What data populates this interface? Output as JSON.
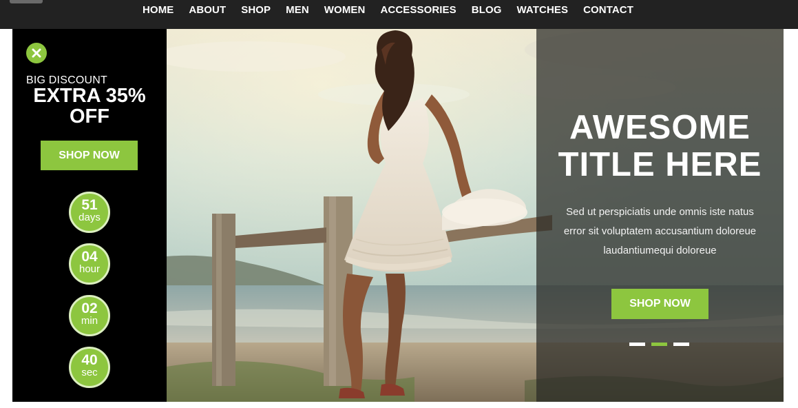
{
  "nav": {
    "items": [
      "HOME",
      "ABOUT",
      "SHOP",
      "MEN",
      "WOMEN",
      "ACCESSORIES",
      "BLOG",
      "WATCHES",
      "CONTACT"
    ]
  },
  "promo": {
    "eyebrow": "BIG DISCOUNT",
    "headline_line1": "EXTRA 35%",
    "headline_line2": "OFF",
    "button_label": "SHOP NOW",
    "countdown": [
      {
        "value": "51",
        "unit": "days"
      },
      {
        "value": "04",
        "unit": "hour"
      },
      {
        "value": "02",
        "unit": "min"
      },
      {
        "value": "40",
        "unit": "sec"
      }
    ]
  },
  "hero": {
    "title_line1": "AWESOME",
    "title_line2": "TITLE HERE",
    "desc_line1": "Sed ut perspiciatis unde omnis iste natus",
    "desc_line2": "error sit voluptatem accusantium doloreue",
    "desc_line3": "laudantiumequi doloreue",
    "button_label": "SHOP NOW",
    "slide_count": 3,
    "active_slide": 2
  },
  "colors": {
    "accent": "#8dc63f",
    "nav_bg": "#222222",
    "promo_bg": "#000000"
  },
  "icons": {
    "close": "close-icon"
  }
}
